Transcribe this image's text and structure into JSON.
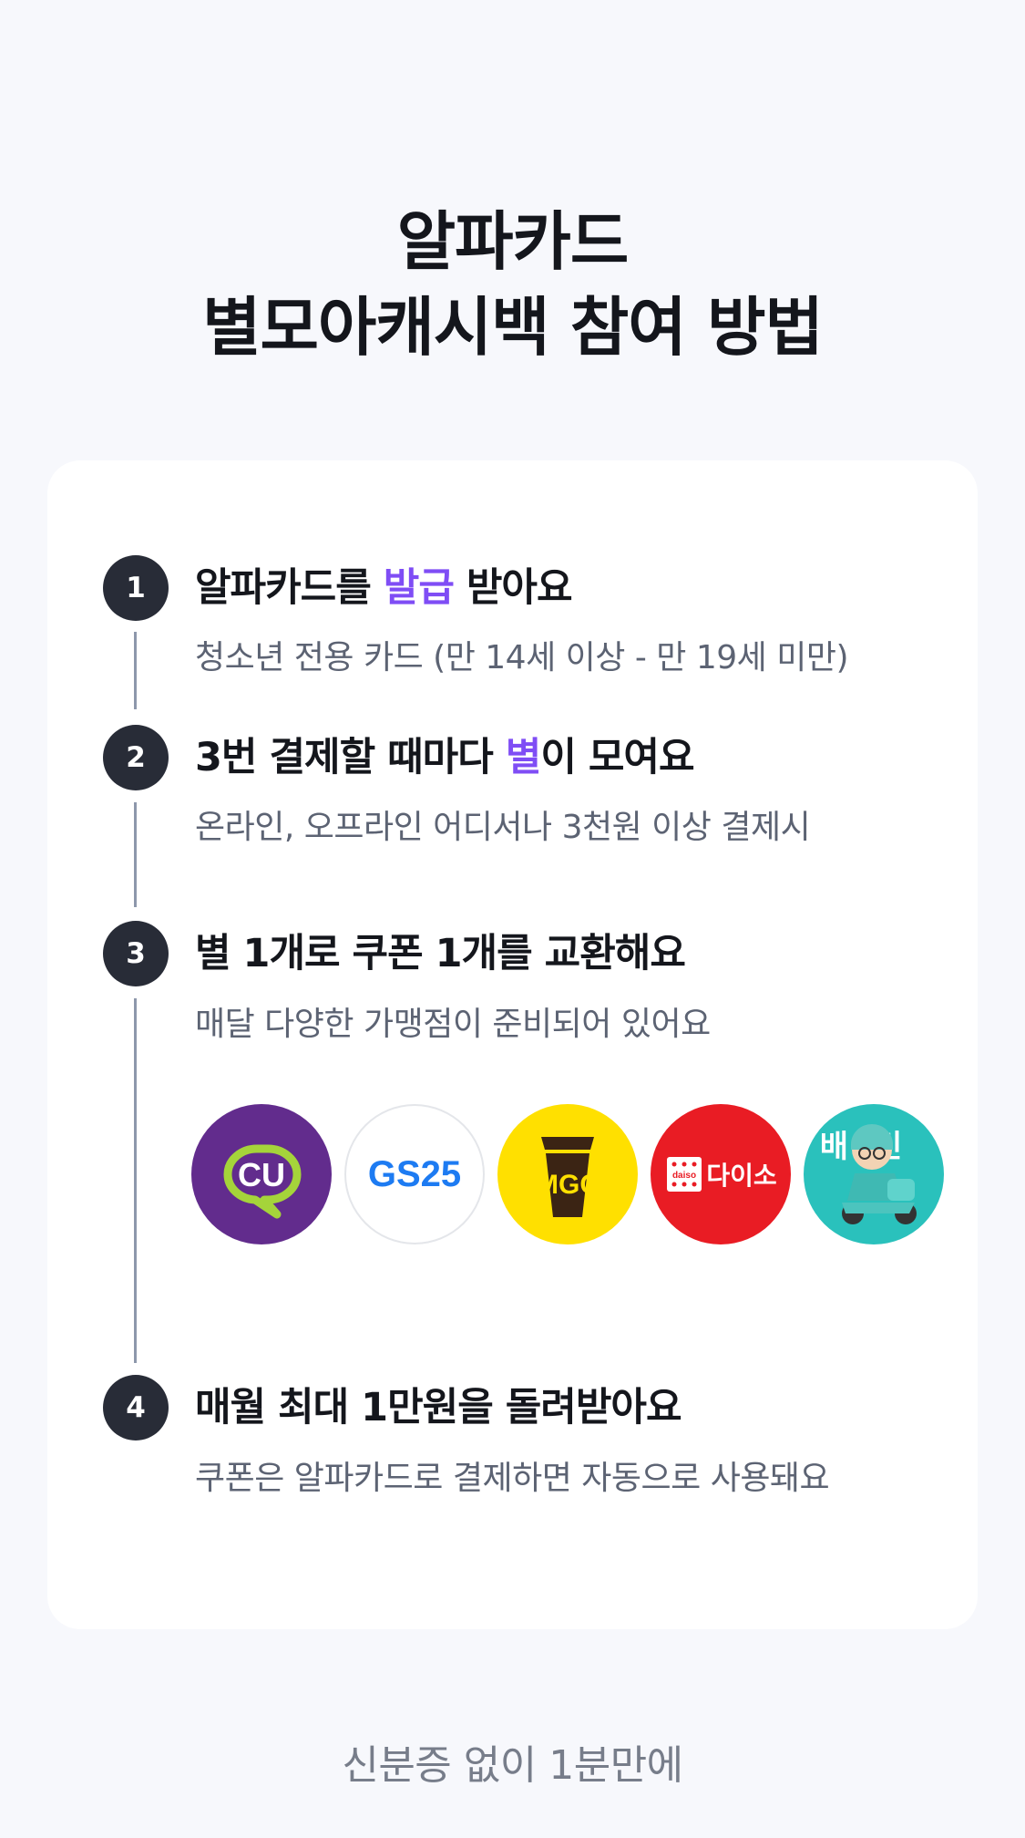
{
  "header": {
    "title_line1": "알파카드",
    "title_line2": "별모아캐시백 참여 방법"
  },
  "steps": [
    {
      "number": "1",
      "title_pre": "알파카드를 ",
      "title_accent": "발급",
      "title_post": " 받아요",
      "description": "청소년 전용 카드 (만 14세 이상 - 만 19세 미만)"
    },
    {
      "number": "2",
      "title_pre": "3번 결제할 때마다 ",
      "title_accent": "별",
      "title_post": "이 모여요",
      "description": "온라인, 오프라인 어디서나 3천원 이상 결제시"
    },
    {
      "number": "3",
      "title": "별 1개로 쿠폰 1개를 교환해요",
      "description": "매달 다양한 가맹점이 준비되어 있어요"
    },
    {
      "number": "4",
      "title": "매월 최대 1만원을 돌려받아요",
      "description": "쿠폰은 알파카드로 결제하면 자동으로 사용돼요"
    }
  ],
  "partners": [
    {
      "icon": "cu-logo-icon",
      "text": "CU",
      "bg": "#622c8d",
      "accent": "#a5d43a"
    },
    {
      "icon": "gs25-logo-icon",
      "text": "GS25",
      "bg": "#ffffff",
      "accent": "#1d7bf2"
    },
    {
      "icon": "mgc-coffee-logo-icon",
      "text": "MGC",
      "bg": "#ffe000",
      "accent": "#3b2414"
    },
    {
      "icon": "daiso-logo-icon",
      "text": "다이소",
      "sub": "daiso",
      "bg": "#e91c24",
      "accent": "#ffffff"
    },
    {
      "icon": "baemin-logo-icon",
      "text": "배민",
      "bg": "#2ac1bc",
      "accent": "#ffffff"
    }
  ],
  "footer": {
    "text": "신분증 없이 1분만에"
  },
  "colors": {
    "accent": "#7f4df5",
    "badge": "#282c37",
    "timeline": "#8d97ab",
    "background": "#f7f8fc"
  }
}
